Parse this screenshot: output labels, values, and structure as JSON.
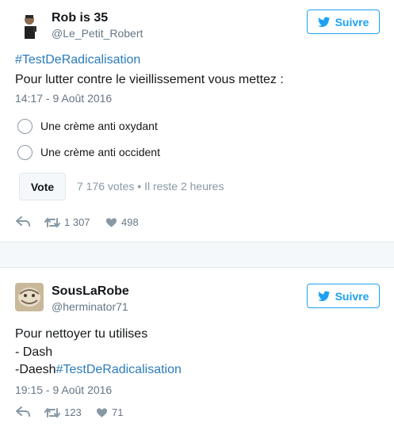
{
  "tweets": [
    {
      "author_name": "Rob is 35",
      "author_handle": "@Le_Petit_Robert",
      "follow_label": "Suivre",
      "hashtag": "#TestDeRadicalisation",
      "text": "Pour lutter contre le vieillissement vous mettez :",
      "timestamp": "14:17 - 9 Août 2016",
      "poll": {
        "options": [
          "Une crème anti oxydant",
          "Une crème anti occident"
        ],
        "vote_label": "Vote",
        "meta": "7 176 votes • Il reste 2 heures"
      },
      "retweets": "1 307",
      "likes": "498"
    },
    {
      "author_name": "SousLaRobe",
      "author_handle": "@herminator71",
      "follow_label": "Suivre",
      "text_line1": "Pour nettoyer tu utilises",
      "text_line2": "- Dash",
      "text_line3_prefix": "-Daesh",
      "hashtag": "#TestDeRadicalisation",
      "timestamp": "19:15 - 9 Août 2016",
      "retweets": "123",
      "likes": "71"
    }
  ],
  "colors": {
    "accent": "#1da1f2",
    "hashtag": "#2b7bb9",
    "muted": "#657786",
    "border": "#e1e8ed"
  }
}
